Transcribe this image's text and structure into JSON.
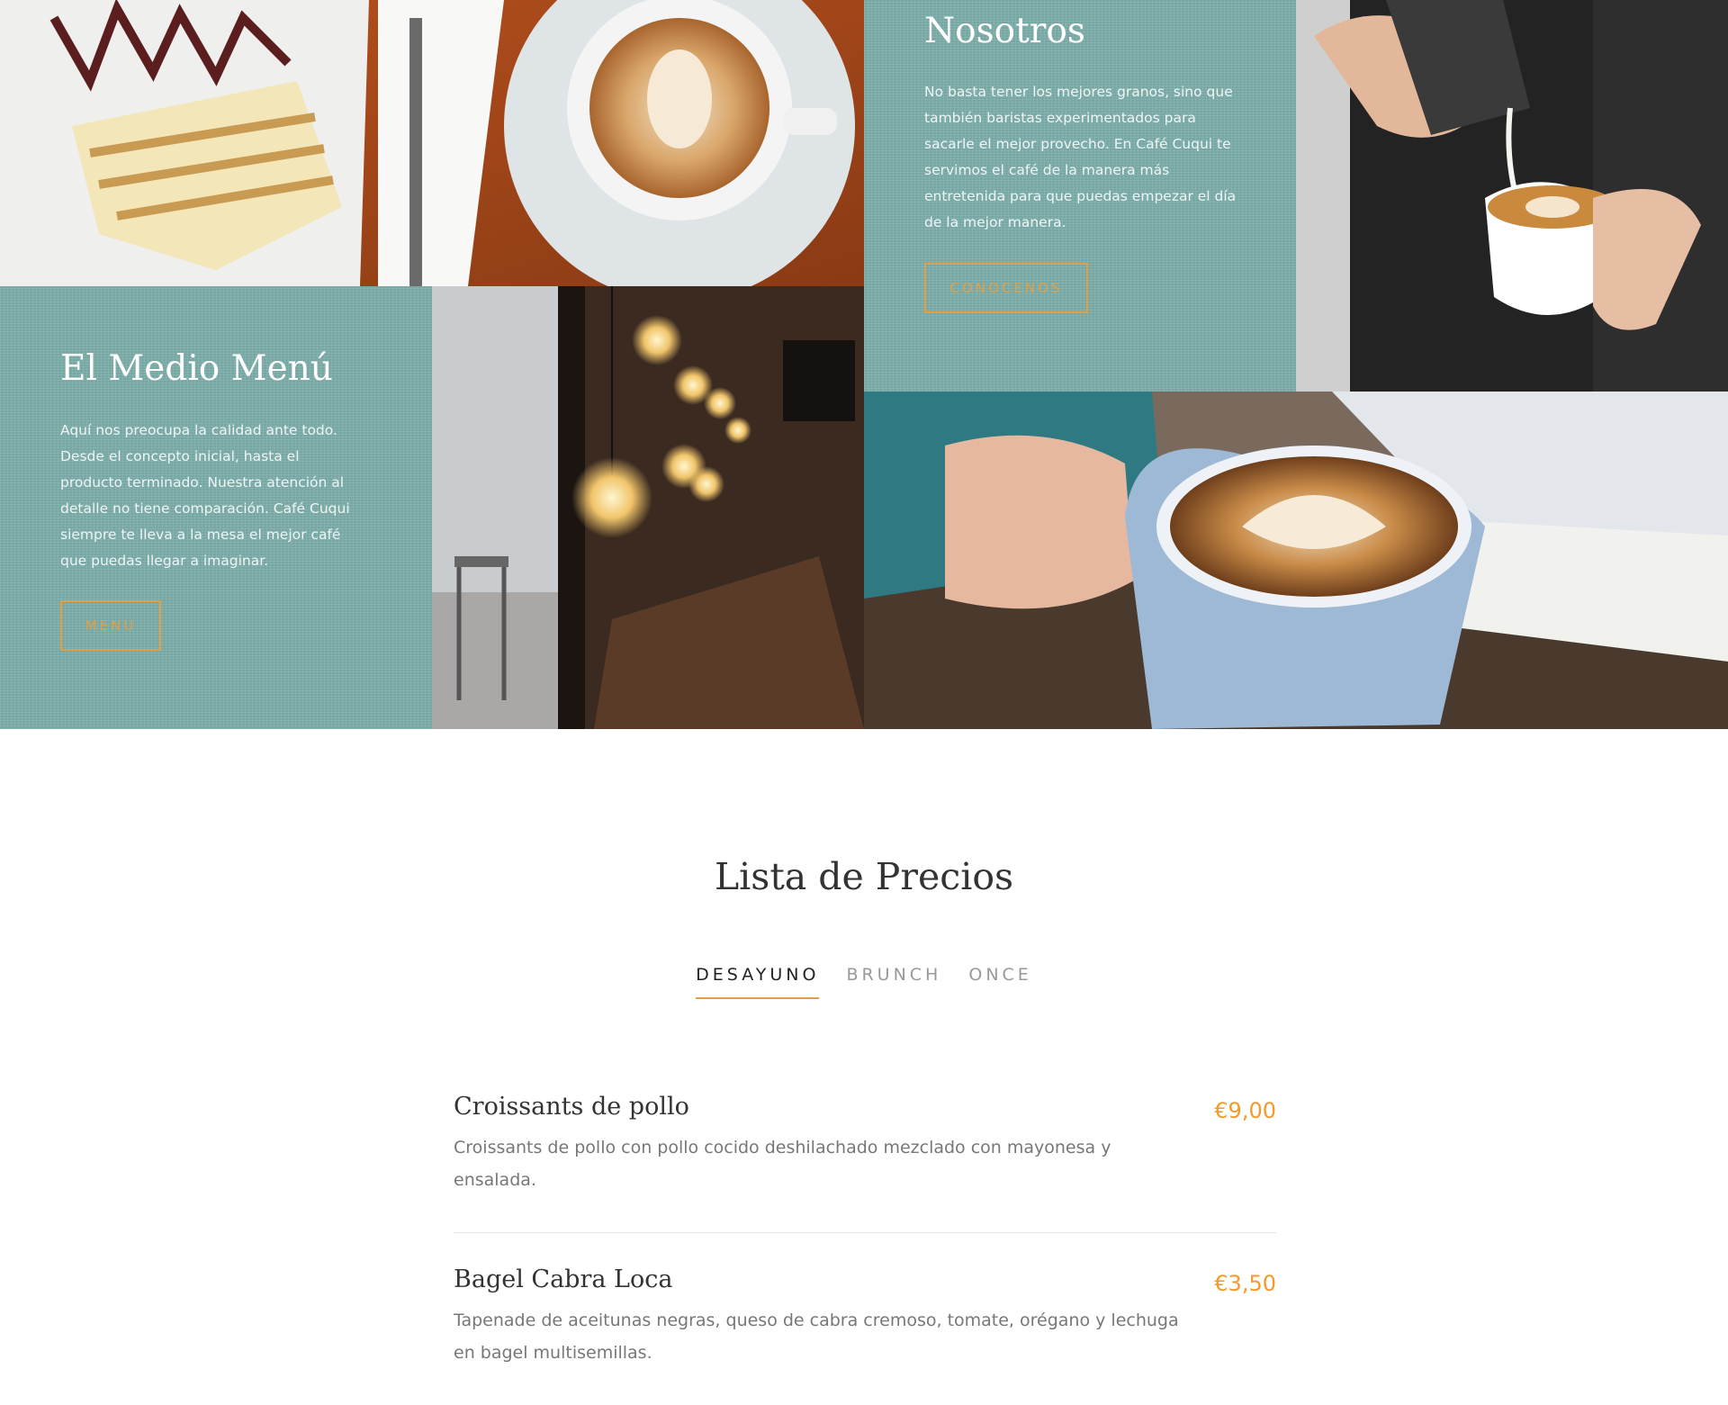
{
  "about": {
    "title": "Nosotros",
    "body": "No basta tener los mejores granos, sino que también baristas experimentados para sacarle el mejor provecho. En Café Cuqui te servimos el café de la manera más entretenida para que puedas empezar el día de la mejor manera.",
    "button_label": "CONOCENOS"
  },
  "menu_promo": {
    "title": "El Medio Menú",
    "body": "Aquí nos preocupa la calidad ante todo. Desde el concepto inicial, hasta el producto terminado. Nuestra atención al detalle no tiene comparación. Café Cuqui siempre te lleva a la mesa el mejor café que puedas llegar a imaginar.",
    "button_label": "MENU"
  },
  "prices": {
    "heading": "Lista de Precios",
    "tabs": [
      {
        "label": "DESAYUNO",
        "active": true
      },
      {
        "label": "BRUNCH",
        "active": false
      },
      {
        "label": "ONCE",
        "active": false
      }
    ],
    "items": [
      {
        "name": "Croissants de pollo",
        "description": "Croissants de pollo con pollo cocido deshilachado mezclado con mayonesa y ensalada.",
        "price": "€9,00"
      },
      {
        "name": "Bagel Cabra Loca",
        "description": "Tapenade de aceitunas negras, queso de cabra cremoso, tomate, orégano y lechuga en bagel multisemillas.",
        "price": "€3,50"
      }
    ]
  },
  "colors": {
    "teal": "#7fb1ad",
    "accent": "#e0a048",
    "price": "#f39a2a"
  }
}
